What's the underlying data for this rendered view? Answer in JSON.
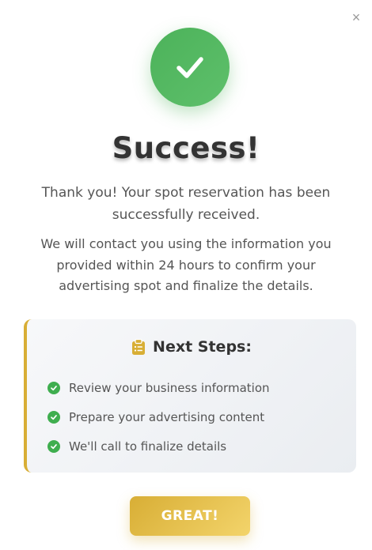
{
  "modal": {
    "close_label": "×",
    "title": "Success!",
    "message_primary": "Thank you! Your spot reservation has been successfully received.",
    "message_secondary": "We will contact you using the information you provided within 24 hours to confirm your advertising spot and finalize the details."
  },
  "next_steps": {
    "icon": "clipboard-list-icon",
    "title": "Next Steps:",
    "items": [
      {
        "label": "Review your business information",
        "icon": "check-circle-icon"
      },
      {
        "label": "Prepare your advertising content",
        "icon": "check-circle-icon"
      },
      {
        "label": "We'll call to finalize details",
        "icon": "check-circle-icon"
      }
    ]
  },
  "actions": {
    "great_label": "GREAT!"
  },
  "colors": {
    "success_green": "#4cb25a",
    "check_green": "#3fae4f",
    "accent_gold": "#d8ae35",
    "title_text": "#333333",
    "body_text": "#555555"
  }
}
